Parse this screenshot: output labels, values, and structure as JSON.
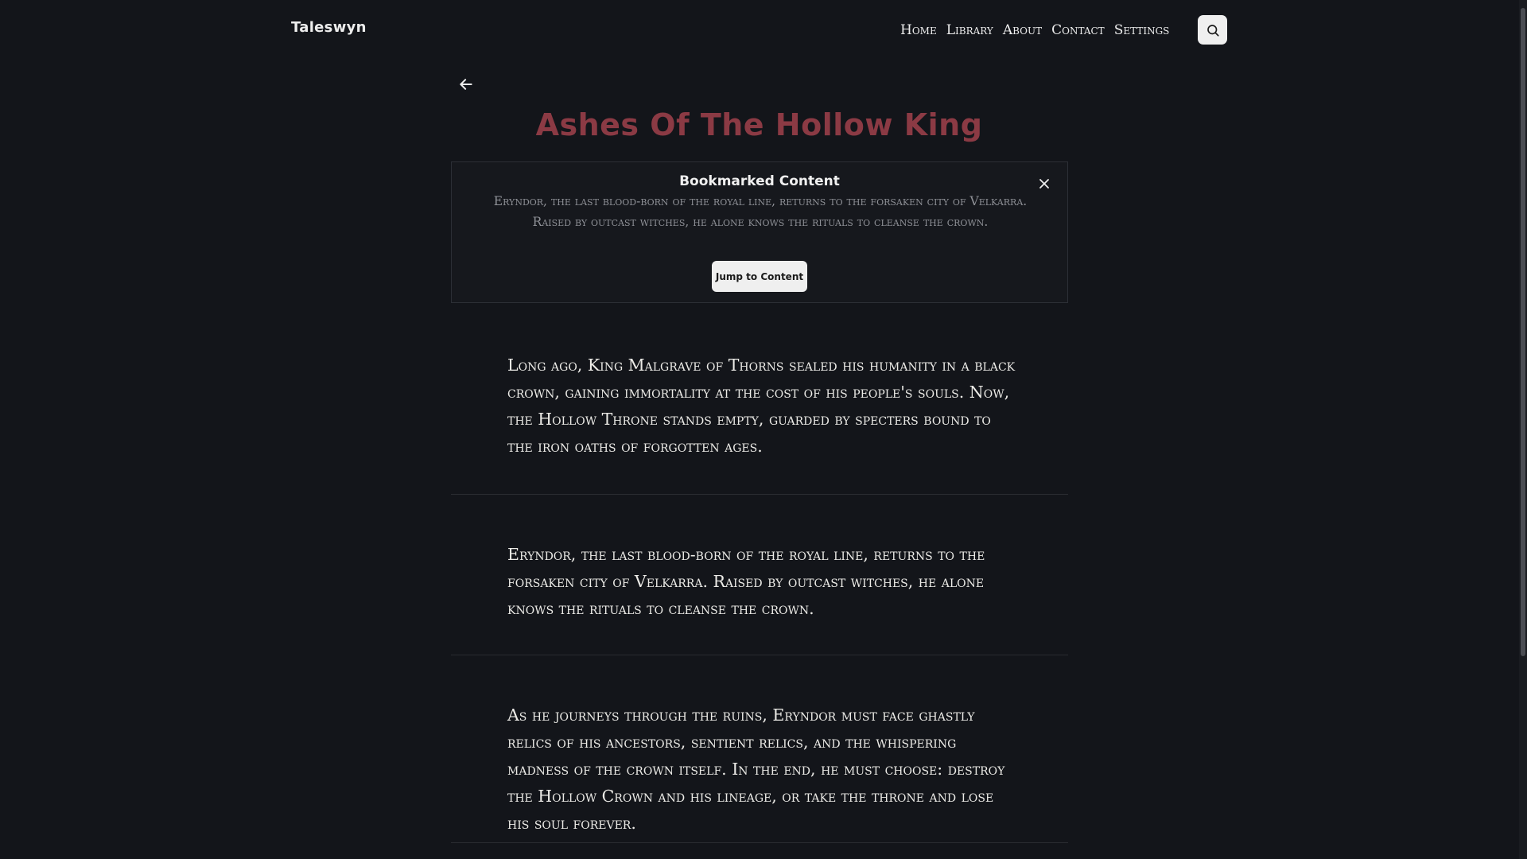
{
  "app": {
    "brand": "Taleswyn"
  },
  "nav": {
    "items": [
      "Home",
      "Library",
      "About",
      "Contact",
      "Settings"
    ],
    "search_icon": "search-icon"
  },
  "story": {
    "title": "Ashes Of The Hollow King"
  },
  "bookmark": {
    "heading": "Bookmarked Content",
    "excerpt": "Eryndor, the last blood-born of the royal line, returns to the forsaken city of Velkarra. Raised by outcast witches, he alone knows the rituals to cleanse the crown.",
    "jump_label": "Jump to Content",
    "close_icon": "close-icon"
  },
  "paragraphs": [
    "Long ago, King Malgrave of Thorns sealed his humanity in a black crown, gaining immortality at the cost of his people's souls. Now, the Hollow Throne stands empty, guarded by specters bound to the iron oaths of forgotten ages.",
    "Eryndor, the last blood-born of the royal line, returns to the forsaken city of Velkarra. Raised by outcast witches, he alone knows the rituals to cleanse the crown.",
    "As he journeys through the ruins, Eryndor must face ghastly relics of his ancestors, sentient relics, and the whispering madness of the crown itself. In the end, he must choose: destroy the Hollow Crown and his lineage, or take the throne and lose his soul forever."
  ],
  "colors": {
    "background": "#13151a",
    "title": "#8b3a44",
    "button": "#efefef"
  }
}
